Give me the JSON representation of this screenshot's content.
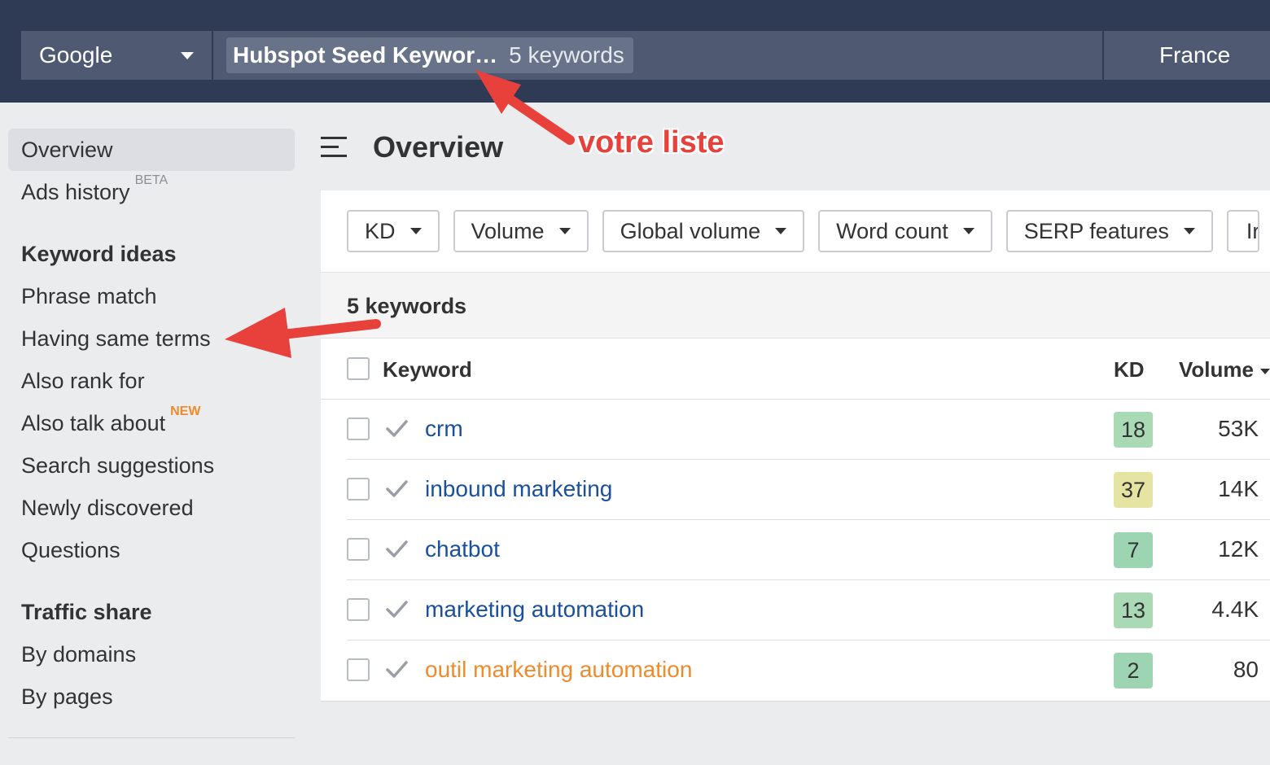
{
  "topbar": {
    "engine": "Google",
    "list_title": "Hubspot Seed Keywor…",
    "list_count": "5 keywords",
    "country": "France"
  },
  "sidebar": {
    "overview": "Overview",
    "ads_history": "Ads history",
    "ads_history_badge": "BETA",
    "keyword_ideas_heading": "Keyword ideas",
    "phrase_match": "Phrase match",
    "having_same_terms": "Having same terms",
    "also_rank_for": "Also rank for",
    "also_talk_about": "Also talk about",
    "also_talk_about_badge": "NEW",
    "search_suggestions": "Search suggestions",
    "newly_discovered": "Newly discovered",
    "questions": "Questions",
    "traffic_share_heading": "Traffic share",
    "by_domains": "By domains",
    "by_pages": "By pages"
  },
  "header": {
    "title": "Overview"
  },
  "filters": {
    "kd": "KD",
    "volume": "Volume",
    "global_volume": "Global volume",
    "word_count": "Word count",
    "serp_features": "SERP features",
    "truncated": "Ir"
  },
  "table": {
    "count_label": "5 keywords",
    "columns": {
      "keyword": "Keyword",
      "kd": "KD",
      "volume": "Volume"
    },
    "rows": [
      {
        "keyword": "crm",
        "kd": "18",
        "volume": "53K",
        "kd_color": "#a9d9b5"
      },
      {
        "keyword": "inbound marketing",
        "kd": "37",
        "volume": "14K",
        "kd_color": "#e6e4a3"
      },
      {
        "keyword": "chatbot",
        "kd": "7",
        "volume": "12K",
        "kd_color": "#9dd5b3"
      },
      {
        "keyword": "marketing automation",
        "kd": "13",
        "volume": "4.4K",
        "kd_color": "#a9d9b5"
      },
      {
        "keyword": "outil marketing automation",
        "kd": "2",
        "volume": "80",
        "kd_color": "#9dd5b3"
      }
    ]
  },
  "annotation": {
    "text": "votre liste",
    "color": "#e8413c"
  },
  "colors": {
    "topbar": "#2f3a55",
    "link": "#1a4f9c",
    "highlight_link": "#ef8b2c"
  }
}
